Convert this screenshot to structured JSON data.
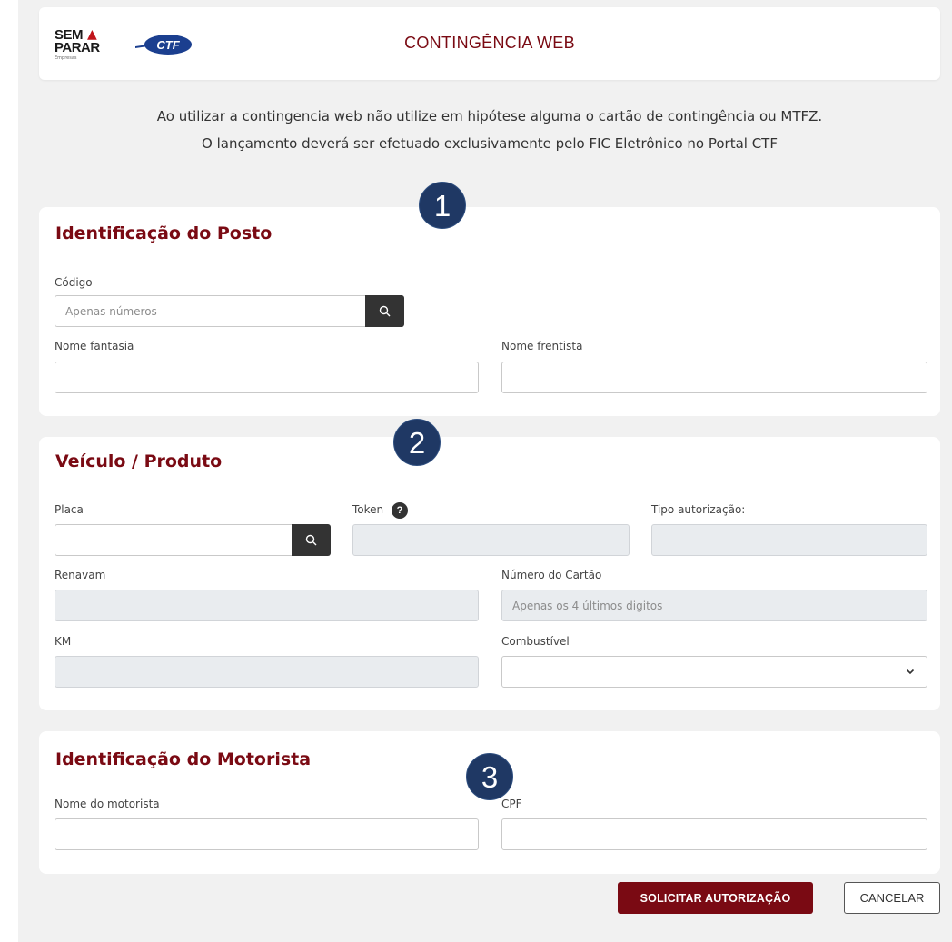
{
  "header": {
    "logo_sem": "SEM",
    "logo_parar": "PARAR",
    "logo_empresas": "Empresas",
    "logo_ctf": "CTF",
    "title": "CONTINGÊNCIA WEB"
  },
  "notice": {
    "line1": "Ao utilizar a contingencia web não utilize em hipótese alguma o cartão de contingência ou MTFZ.",
    "line2": "O lançamento deverá ser efetuado exclusivamente pelo FIC Eletrônico no Portal CTF"
  },
  "posto": {
    "badge": "1",
    "title": "Identificação do Posto",
    "codigo_label": "Código",
    "codigo_placeholder": "Apenas números",
    "codigo_value": "",
    "nome_fantasia_label": "Nome fantasia",
    "nome_fantasia_value": "",
    "nome_frentista_label": "Nome frentista",
    "nome_frentista_value": ""
  },
  "veiculo": {
    "badge": "2",
    "title": "Veículo / Produto",
    "placa_label": "Placa",
    "placa_value": "",
    "token_label": "Token",
    "token_help": "?",
    "token_value": "",
    "tipo_label": "Tipo autorização:",
    "tipo_value": "",
    "renavam_label": "Renavam",
    "renavam_value": "",
    "cartao_label": "Número do Cartão",
    "cartao_placeholder": "Apenas os 4 últimos digitos",
    "cartao_value": "",
    "km_label": "KM",
    "km_value": "",
    "combustivel_label": "Combustível",
    "combustivel_value": ""
  },
  "motorista": {
    "badge": "3",
    "title": "Identificação do Motorista",
    "nome_label": "Nome do motorista",
    "nome_value": "",
    "cpf_label": "CPF",
    "cpf_value": ""
  },
  "actions": {
    "submit_label": "SOLICITAR AUTORIZAÇÃO",
    "cancel_label": "CANCELAR"
  },
  "colors": {
    "brand": "#7a0a13",
    "badge": "#1f3864",
    "background": "#f1f1f1",
    "disabled": "#e9ecef"
  },
  "icons": [
    "search-icon",
    "chevron-down-icon",
    "help-icon",
    "ctf-logo",
    "sem-parar-logo"
  ]
}
